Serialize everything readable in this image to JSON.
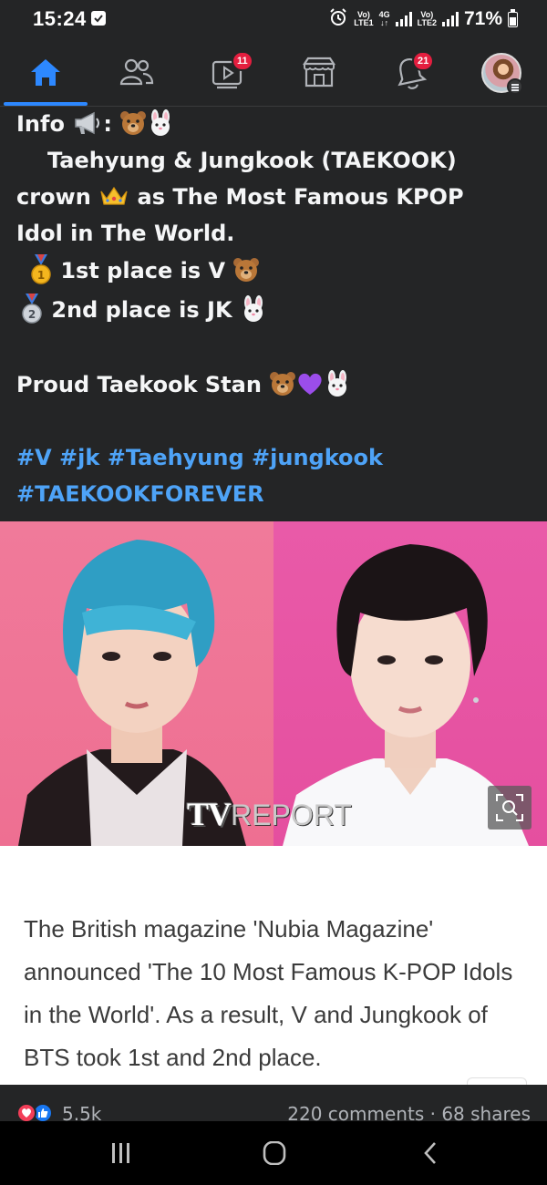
{
  "status_bar": {
    "time": "15:24",
    "sim1_label": "Vo)",
    "sim1_type": "LTE1",
    "network_type": "4G",
    "sim2_label": "Vo)",
    "sim2_type": "LTE2",
    "battery_percent": "71%",
    "icons": [
      "check-notification-icon",
      "alarm-icon",
      "signal-icon",
      "battery-icon"
    ]
  },
  "nav": {
    "items": [
      {
        "name": "home",
        "icon": "home-icon",
        "active": true
      },
      {
        "name": "friends",
        "icon": "friends-icon"
      },
      {
        "name": "watch",
        "icon": "watch-icon",
        "badge": "11"
      },
      {
        "name": "marketplace",
        "icon": "marketplace-icon"
      },
      {
        "name": "notifications",
        "icon": "bell-icon",
        "badge": "21"
      },
      {
        "name": "menu",
        "icon": "avatar-menu-icon"
      }
    ],
    "accent_color": "#2d88ff",
    "badge_color": "#e41e3f"
  },
  "post": {
    "lines": {
      "l1": "Info",
      "l1_sep": ":",
      "l2": "Taehyung & Jungkook (TAEKOOK)",
      "l3a": "crown",
      "l3b": "as The Most Famous KPOP",
      "l4": "Idol in The World.",
      "l5": "1st place is V",
      "l6": "2nd place is JK",
      "l7": "Proud Taekook Stan"
    },
    "hashtags": {
      "h1": "#V",
      "h2": "#jk",
      "h3": "#Taehyung",
      "h4": "#jungkook",
      "h5": "#TAEKOOKFOREVER"
    },
    "emoji_icons": [
      "megaphone-icon",
      "bear-icon",
      "bunny-icon",
      "crown-icon",
      "gold-medal-icon",
      "silver-medal-icon",
      "purple-heart-icon"
    ],
    "hashtag_color": "#4ea3f7"
  },
  "photo": {
    "watermark_a": "TV",
    "watermark_b": "REPORT",
    "left_bg": "#f07a9a",
    "right_bg": "#e95aa8"
  },
  "article": {
    "text": "The British magazine 'Nubia Magazine' announced 'The 10 Most Famous K-POP Idols in the World'. As a result, V and Jungkook of BTS took 1st and 2nd place."
  },
  "reactions": {
    "count": "5.5k",
    "comments": "220 comments",
    "separator": "·",
    "shares": "68 shares"
  },
  "android_nav": {
    "icons": [
      "recents-icon",
      "home-circle-icon",
      "back-icon"
    ]
  }
}
